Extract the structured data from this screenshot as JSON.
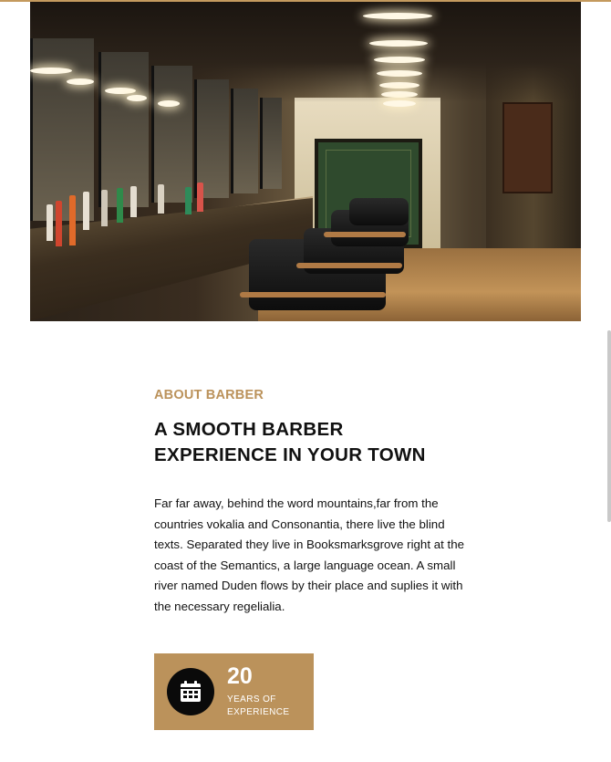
{
  "hero": {
    "image_subject": "barbershop interior"
  },
  "about": {
    "eyebrow": "ABOUT BARBER",
    "title_line1": "A SMOOTH BARBER",
    "title_line2": "EXPERIENCE IN YOUR TOWN",
    "body": "Far far away, behind the word mountains,far from the countries vokalia and Consonantia, there live the blind texts. Separated they live in Booksmarksgrove right at the coast of the Semantics, a large language ocean. A small river named Duden flows by their place and suplies it with the necessary regelialia."
  },
  "stat": {
    "icon": "calendar-icon",
    "number": "20",
    "label_line1": "YEARS OF",
    "label_line2": "EXPERIENCE"
  },
  "colors": {
    "accent": "#bb925b",
    "text": "#111111",
    "icon_bg": "#0a0a0a"
  }
}
